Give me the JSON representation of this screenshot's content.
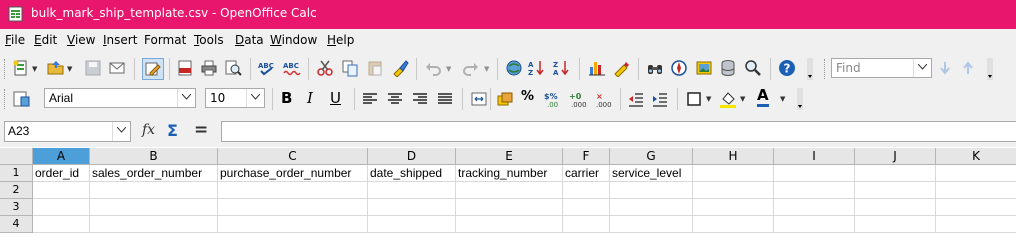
{
  "window": {
    "title": "bulk_mark_ship_template.csv - OpenOffice Calc",
    "titlebar_color": "#e8166c"
  },
  "menu": {
    "items": [
      {
        "label": "File",
        "key": "F",
        "rest": "ile"
      },
      {
        "label": "Edit",
        "key": "E",
        "rest": "dit"
      },
      {
        "label": "View",
        "key": "V",
        "rest": "iew"
      },
      {
        "label": "Insert",
        "key": "I",
        "rest": "nsert"
      },
      {
        "label": "Format",
        "key": "F",
        "rest": "ormat",
        "prefix": ""
      },
      {
        "label": "Tools",
        "key": "T",
        "rest": "ools"
      },
      {
        "label": "Data",
        "key": "D",
        "rest": "ata"
      },
      {
        "label": "Window",
        "key": "W",
        "rest": "indow"
      },
      {
        "label": "Help",
        "key": "H",
        "rest": "elp"
      }
    ]
  },
  "toolbar": {
    "find_placeholder": "Find",
    "font_name": "Arial",
    "font_size": "10",
    "bold": "B",
    "italic": "I",
    "underline": "U",
    "percent": "%",
    "font_color_letter": "A"
  },
  "formula_bar": {
    "name_box": "A23",
    "function_wizard": "fx",
    "sum": "Σ",
    "equals": "=",
    "content": ""
  },
  "sheet": {
    "selected_column": "A",
    "columns": [
      "A",
      "B",
      "C",
      "D",
      "E",
      "F",
      "G",
      "H",
      "I",
      "J",
      "K"
    ],
    "rows": [
      "1",
      "2",
      "3",
      "4"
    ],
    "cells": [
      [
        "order_id",
        "sales_order_number",
        "purchase_order_number",
        "date_shipped",
        "tracking_number",
        "carrier",
        "service_level",
        "",
        "",
        "",
        ""
      ],
      [
        "",
        "",
        "",
        "",
        "",
        "",
        "",
        "",
        "",
        "",
        ""
      ],
      [
        "",
        "",
        "",
        "",
        "",
        "",
        "",
        "",
        "",
        "",
        ""
      ],
      [
        "",
        "",
        "",
        "",
        "",
        "",
        "",
        "",
        "",
        "",
        ""
      ]
    ]
  }
}
